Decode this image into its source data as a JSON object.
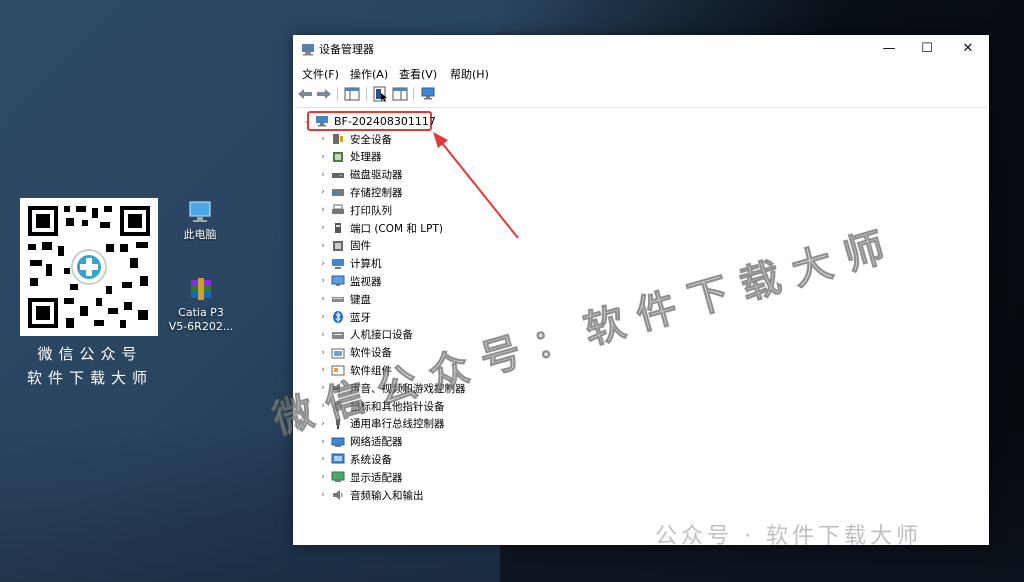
{
  "desktop": {
    "qr_caption_line1": "微信公众号",
    "qr_caption_line2": "软件下载大师",
    "icons": [
      {
        "label": "此电脑",
        "icon": "computer-icon"
      },
      {
        "label": "Catia P3 V5-6R202...",
        "label_line1": "Catia P3",
        "label_line2": "V5-6R202...",
        "icon": "winrar-archive-icon"
      }
    ]
  },
  "window": {
    "title": "设备管理器",
    "menu": [
      "文件(F)",
      "操作(A)",
      "查看(V)",
      "帮助(H)"
    ],
    "controls": {
      "minimize": "—",
      "maximize": "☐",
      "close": "✕"
    },
    "tree": {
      "root": "BF-202408301117",
      "items": [
        {
          "label": "安全设备",
          "icon": "security-device-icon"
        },
        {
          "label": "处理器",
          "icon": "processor-icon"
        },
        {
          "label": "磁盘驱动器",
          "icon": "disk-drive-icon"
        },
        {
          "label": "存储控制器",
          "icon": "storage-controller-icon"
        },
        {
          "label": "打印队列",
          "icon": "print-queue-icon"
        },
        {
          "label": "端口 (COM 和 LPT)",
          "icon": "port-icon"
        },
        {
          "label": "固件",
          "icon": "firmware-icon"
        },
        {
          "label": "计算机",
          "icon": "computer-icon"
        },
        {
          "label": "监视器",
          "icon": "monitor-icon"
        },
        {
          "label": "键盘",
          "icon": "keyboard-icon"
        },
        {
          "label": "蓝牙",
          "icon": "bluetooth-icon"
        },
        {
          "label": "人机接口设备",
          "icon": "hid-icon"
        },
        {
          "label": "软件设备",
          "icon": "software-device-icon"
        },
        {
          "label": "软件组件",
          "icon": "software-component-icon"
        },
        {
          "label": "声音、视频和游戏控制器",
          "icon": "sound-icon"
        },
        {
          "label": "鼠标和其他指针设备",
          "icon": "mouse-icon"
        },
        {
          "label": "通用串行总线控制器",
          "icon": "usb-icon"
        },
        {
          "label": "网络适配器",
          "icon": "network-adapter-icon"
        },
        {
          "label": "系统设备",
          "icon": "system-device-icon"
        },
        {
          "label": "显示适配器",
          "icon": "display-adapter-icon"
        },
        {
          "label": "音频输入和输出",
          "icon": "audio-io-icon"
        }
      ]
    }
  },
  "watermarks": {
    "main": "微信公众号：软件下载大师",
    "bottom": "公众号 · 软件下载大师"
  },
  "colors": {
    "highlight_red": "#e53935",
    "desktop_blue": "#2d4a66"
  }
}
